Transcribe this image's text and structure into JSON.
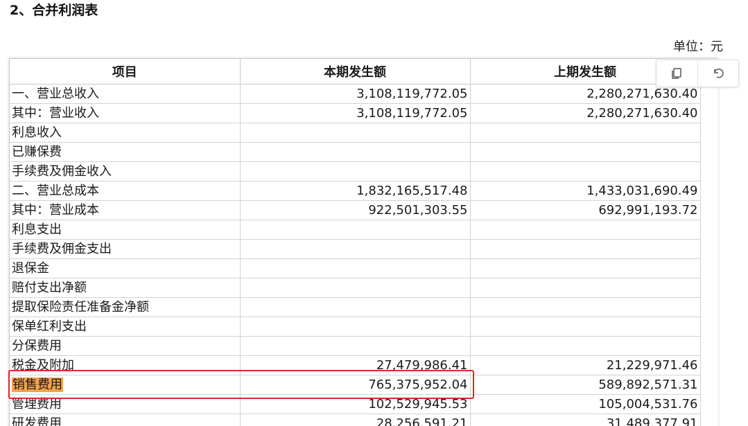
{
  "section": {
    "title": "2、合并利润表",
    "unit": "单位：元"
  },
  "table": {
    "headers": [
      "项目",
      "本期发生额",
      "上期发生额"
    ],
    "rows": [
      {
        "item": "一、营业总收入",
        "current": "3,108,119,772.05",
        "previous": "2,280,271,630.40"
      },
      {
        "item": "其中：营业收入",
        "current": "3,108,119,772.05",
        "previous": "2,280,271,630.40"
      },
      {
        "item": "利息收入",
        "current": "",
        "previous": ""
      },
      {
        "item": "已赚保费",
        "current": "",
        "previous": ""
      },
      {
        "item": "手续费及佣金收入",
        "current": "",
        "previous": ""
      },
      {
        "item": "二、营业总成本",
        "current": "1,832,165,517.48",
        "previous": "1,433,031,690.49"
      },
      {
        "item": "其中：营业成本",
        "current": "922,501,303.55",
        "previous": "692,991,193.72"
      },
      {
        "item": "利息支出",
        "current": "",
        "previous": ""
      },
      {
        "item": "手续费及佣金支出",
        "current": "",
        "previous": ""
      },
      {
        "item": "退保金",
        "current": "",
        "previous": ""
      },
      {
        "item": "赔付支出净额",
        "current": "",
        "previous": ""
      },
      {
        "item": "提取保险责任准备金净额",
        "current": "",
        "previous": ""
      },
      {
        "item": "保单红利支出",
        "current": "",
        "previous": ""
      },
      {
        "item": "分保费用",
        "current": "",
        "previous": ""
      },
      {
        "item": "税金及附加",
        "current": "27,479,986.41",
        "previous": "21,229,971.46"
      },
      {
        "item": "销售费用",
        "current": "765,375,952.04",
        "previous": "589,892,571.31",
        "highlight": true
      },
      {
        "item": "管理费用",
        "current": "102,529,945.53",
        "previous": "105,004,531.76"
      },
      {
        "item": "研发费用",
        "current": "28,256,591.21",
        "previous": "31,489,377.91"
      }
    ]
  },
  "toolbar": {
    "icons": [
      "copy-icon",
      "undo-icon"
    ]
  },
  "colors": {
    "highlight": "#f2a24a",
    "annotation_box": "#e0262b"
  }
}
